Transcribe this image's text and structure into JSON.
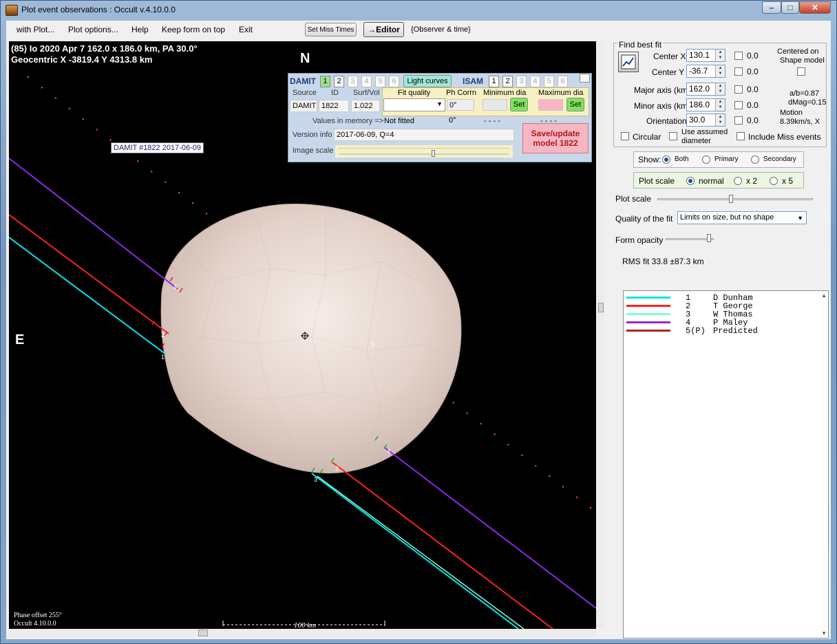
{
  "window": {
    "title": "Plot event observations : Occult v.4.10.0.0",
    "buttons": {
      "minimize": "–",
      "maximize": "□",
      "close": "✕"
    }
  },
  "menu": {
    "items": [
      "with Plot...",
      "Plot options...",
      "Help",
      "Keep form on top",
      "Exit"
    ],
    "set_miss_times": "Set Miss Times",
    "editor": "→Editor",
    "observer_time": "{Observer & time}"
  },
  "plot": {
    "header_line1": "(85) Io  2020 Apr 7  162.0 x 186.0 km,  PA 30.0°",
    "header_line2": "Geocentric  X  -3819.4  Y 4313.8 km",
    "north_label": "N",
    "east_label": "E",
    "model_tag": "DAMIT #1822 2017-06-09",
    "phase_offset": "Phase offset 255°",
    "version": "Occult 4.10.0.0",
    "scale_label": "100 km",
    "chord_labels": [
      "1",
      "2",
      "3",
      "4",
      "5"
    ],
    "colors": {
      "cyan": "#00e5ee",
      "red": "#ff1e1e",
      "aqua": "#7fffd4",
      "purple": "#8a2be2",
      "body": "#e8d8d0"
    }
  },
  "damit_panel": {
    "damit_label": "DAMIT",
    "damit_buttons": [
      "1",
      "2",
      "3",
      "4",
      "5",
      "6"
    ],
    "light_curves": "Light curves",
    "isam_label": "ISAM",
    "isam_buttons": [
      "1",
      "2",
      "3",
      "4",
      "5",
      "6"
    ],
    "col_source": "Source",
    "col_id": "ID",
    "col_surfvol": "Surf/Vol",
    "source": "DAMIT",
    "id": "1822",
    "surfvol": "1.022",
    "fit_quality": "Fit quality",
    "ph_corrn": "Ph Corrn",
    "min_dia": "Minimum dia",
    "max_dia": "Maximum dia",
    "ph_corrn_value": "0°",
    "set1": "Set",
    "set2": "Set",
    "values_in_memory": "Values in memory =>",
    "not_fitted": "Not fitted",
    "ph_zero": "0°",
    "dashes1": "- - - -",
    "dashes2": "- - - -",
    "version_info_label": "Version info",
    "version_info": "2017-06-09, Q=4",
    "image_scale_label": "Image scale",
    "save_update": "Save/update model 1822"
  },
  "right_panel": {
    "find_best_fit": "Find best fit",
    "center_x_label": "Center X",
    "center_x": "130.1",
    "center_y_label": "Center Y",
    "center_y": "-36.7",
    "major_label": "Major axis (km)",
    "major": "162.0",
    "minor_label": "Minor axis (km)",
    "minor": "186.0",
    "orient_label": "Orientation",
    "orient": "30.0",
    "zero_vals": [
      "0.0",
      "0.0",
      "0.0",
      "0.0",
      "0.0"
    ],
    "centered_on": "Centered on",
    "shape_model": "Shape model",
    "ab_ratio": "a/b=0.87",
    "dmag": "dMag=0.15",
    "motion": "Motion",
    "motion_val": "8.39km/s, X",
    "circular": "Circular",
    "use_assumed": "Use assumed",
    "diameter": "diameter",
    "include_miss": "Include Miss events",
    "show_label": "Show:",
    "show_both": "Both",
    "show_primary": "Primary",
    "show_secondary": "Secondary",
    "plot_scale_label": "Plot scale",
    "scale_normal": "normal",
    "scale_x2": "x 2",
    "scale_x5": "x 5",
    "plot_scale_slider_label": "Plot scale",
    "quality_label": "Quality of the fit",
    "quality_value": "Limits on size, but no shape",
    "form_opacity": "Form opacity",
    "rms_fit": "RMS fit 33.8 ±87.3 km"
  },
  "legend": [
    {
      "num": "1",
      "name": "D Dunham",
      "color": "#00e5ee"
    },
    {
      "num": "2",
      "name": "T George",
      "color": "#ff1e1e"
    },
    {
      "num": "3",
      "name": "W Thomas",
      "color": "#7fffd4"
    },
    {
      "num": "4",
      "name": "P Maley",
      "color": "#8a2be2"
    },
    {
      "num": "5(P)",
      "name": "Predicted",
      "color": "#b22222"
    }
  ]
}
